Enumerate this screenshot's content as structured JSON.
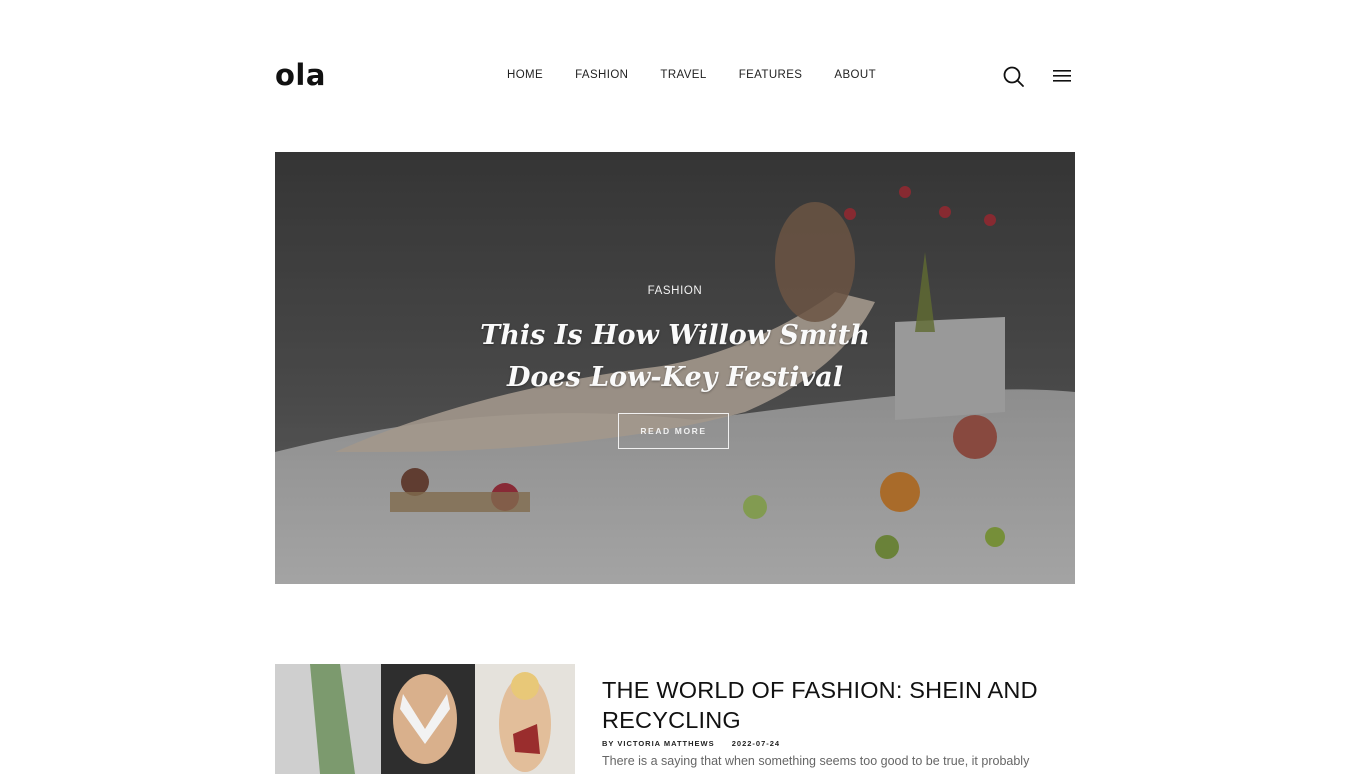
{
  "brand": {
    "logo": "ola"
  },
  "nav": {
    "items": [
      "HOME",
      "FASHION",
      "TRAVEL",
      "FEATURES",
      "ABOUT"
    ]
  },
  "header_icons": {
    "search": "search-icon",
    "menu": "hamburger-menu-icon"
  },
  "hero": {
    "category": "FASHION",
    "title_line1": "This Is How Willow Smith",
    "title_line2": "Does Low-Key Festival",
    "button_label": "READ  MORE"
  },
  "posts": [
    {
      "title": "THE WORLD OF FASHION: SHEIN AND RECYCLING",
      "author": "BY VICTORIA MATTHEWS",
      "date": "2022-07-24",
      "excerpt": "There is a saying that when something seems too good to be true, it probably"
    }
  ]
}
